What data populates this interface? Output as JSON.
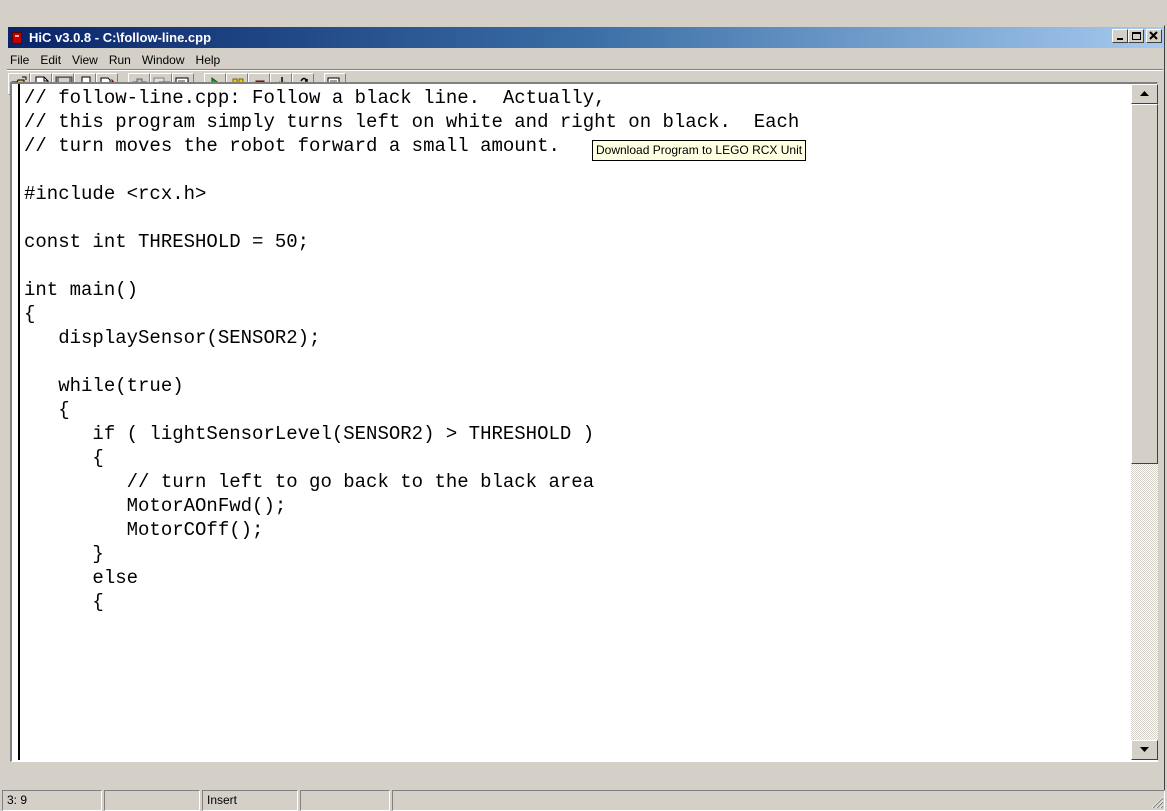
{
  "window": {
    "title": "HiC v3.0.8 - C:\\follow-line.cpp"
  },
  "menubar": {
    "items": [
      "File",
      "Edit",
      "View",
      "Run",
      "Window",
      "Help"
    ]
  },
  "toolbar": {
    "buttons": [
      "open-icon",
      "new-icon",
      "save-icon",
      "print-icon",
      "export-icon",
      "find-icon",
      "replace-icon",
      "compile-icon",
      "run-icon",
      "pause-icon",
      "stop-icon",
      "step-into-icon",
      "step-over-icon",
      "download-icon"
    ]
  },
  "tooltip": {
    "text": "Download Program to LEGO RCX Unit"
  },
  "editor": {
    "lines": [
      "// follow-line.cpp: Follow a black line.  Actually,",
      "// this program simply turns left on white and right on black.  Each",
      "// turn moves the robot forward a small amount.",
      "",
      "#include <rcx.h>",
      "",
      "const int THRESHOLD = 50;",
      "",
      "int main()",
      "{",
      "   displaySensor(SENSOR2);",
      "",
      "   while(true)",
      "   {",
      "      if ( lightSensorLevel(SENSOR2) > THRESHOLD )",
      "      {",
      "         // turn left to go back to the black area",
      "         MotorAOnFwd();",
      "         MotorCOff();",
      "      }",
      "      else",
      "      {"
    ]
  },
  "statusbar": {
    "position": "3: 9",
    "panel2": "",
    "mode": "Insert",
    "panel4": "",
    "panel5": ""
  },
  "colors": {
    "titlebar_start": "#0a246a",
    "titlebar_end": "#a6caf0",
    "chrome": "#d4d0c8",
    "tooltip_bg": "#ffffe1"
  }
}
